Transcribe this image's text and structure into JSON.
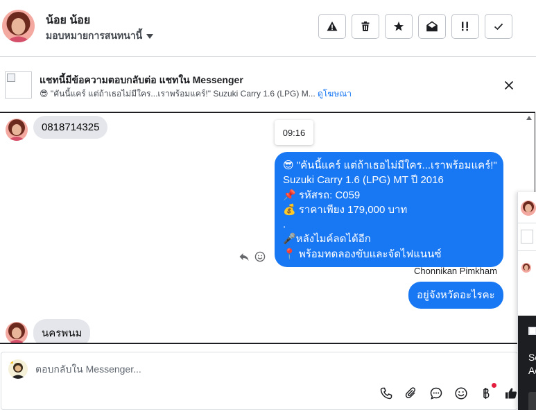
{
  "header": {
    "contact_name": "น้อย น้อย",
    "assign_label": "มอบหมายการสนทนานี้",
    "actions": [
      {
        "icon": "warning-icon"
      },
      {
        "icon": "trash-icon"
      },
      {
        "icon": "star-icon"
      },
      {
        "icon": "mark-unread-icon"
      },
      {
        "icon": "follow-up-icon"
      },
      {
        "icon": "check-icon"
      }
    ]
  },
  "banner": {
    "title": "แชทนี้มีข้อความตอบกลับต่อ แชทใน Messenger",
    "ad_text": "😎 \"คันนี้แคร์ แต่ถ้าเธอไม่มีใคร...เราพร้อมแคร์!\" Suzuki Carry 1.6 (LPG) M...",
    "ad_link": "ดูโฆษณา",
    "close_icon": "close-icon"
  },
  "chat": {
    "incoming_1": "0818714325",
    "time_chip": "09:16",
    "outgoing_1_lines": [
      "😎 \"คันนี้แคร์ แต่ถ้าเธอไม่มีใคร...เราพร้อมแคร์!\"",
      "Suzuki Carry 1.6 (LPG) MT ปี 2016",
      "📌 รหัสรถ: C059",
      "💰 ราคาเพียง 179,000 บาท",
      ".",
      "🎤หลังไมค์ลดได้อีก",
      "📍 พร้อมทดลองขับและจัดไฟแนนซ์"
    ],
    "sender": "Chonnikan Pimkham",
    "outgoing_2": "อยู่จังหวัดอะไรคะ",
    "incoming_2": "นครพนม"
  },
  "composer": {
    "placeholder": "ตอบกลับใน Messenger...",
    "tools": [
      "phone-icon",
      "attachment-icon",
      "saved-reply-icon",
      "emoji-icon",
      "baht-icon",
      "like-icon"
    ]
  },
  "side_panel": {
    "text_1": "Sc",
    "text_2": "Ac"
  },
  "colors": {
    "brand_blue": "#1877f2",
    "bubble_grey": "#e4e6eb",
    "notification_red": "#e41e3f"
  }
}
